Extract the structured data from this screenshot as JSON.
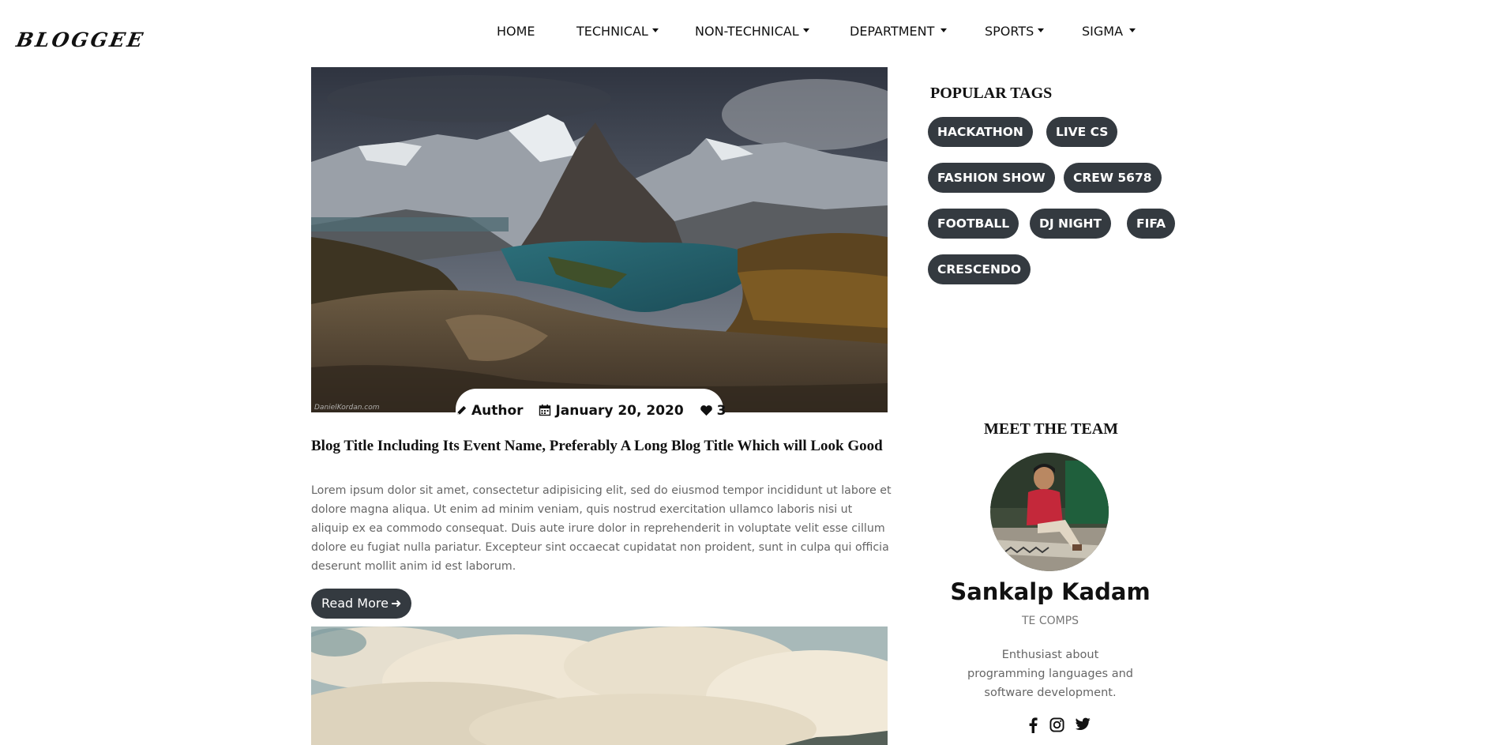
{
  "brand": {
    "logo": "BLOGGEE"
  },
  "nav": [
    {
      "label": "HOME",
      "dropdown": false
    },
    {
      "label": "TECHNICAL",
      "dropdown": true
    },
    {
      "label": "NON-TECHNICAL",
      "dropdown": true
    },
    {
      "label": "DEPARTMENT",
      "dropdown": true
    },
    {
      "label": "SPORTS",
      "dropdown": true
    },
    {
      "label": "SIGMA",
      "dropdown": true
    }
  ],
  "post": {
    "image_watermark": "DanielKordan.com",
    "author": "Author",
    "date": "January 20, 2020",
    "likes": "3",
    "title": "Blog Title Including Its Event Name, Preferably A Long Blog Title Which will Look Good",
    "body": "Lorem ipsum dolor sit amet, consectetur adipisicing elit, sed do eiusmod tempor incididunt ut labore et dolore magna aliqua. Ut enim ad minim veniam, quis nostrud exercitation ullamco laboris nisi ut aliquip ex ea commodo consequat. Duis aute irure dolor in reprehenderit in voluptate velit esse cillum dolore eu fugiat nulla pariatur. Excepteur sint occaecat cupidatat non proident, sunt in culpa qui officia deserunt mollit anim id est laborum.",
    "read_more": "Read More"
  },
  "sidebar": {
    "tags_heading": "POPULAR TAGS",
    "tags": [
      "HACKATHON",
      "LIVE CS",
      "FASHION SHOW",
      "CREW 5678",
      "FOOTBALL",
      "DJ NIGHT",
      "FIFA",
      "CRESCENDO"
    ],
    "team_heading": "MEET THE TEAM",
    "member": {
      "name": "Sankalp Kadam",
      "role": "TE COMPS",
      "bio": "Enthusiast about programming languages and software development."
    },
    "social": [
      "facebook-icon",
      "instagram-icon",
      "twitter-icon"
    ]
  },
  "colors": {
    "dark_pill": "#343a40",
    "text_muted": "#666666"
  }
}
